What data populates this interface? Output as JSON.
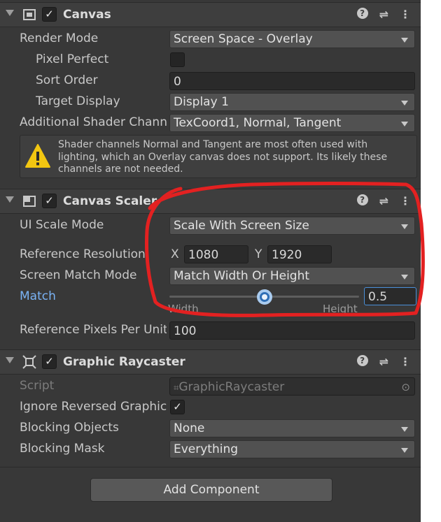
{
  "canvas": {
    "title": "Canvas",
    "enabled": true,
    "render_mode": {
      "label": "Render Mode",
      "value": "Screen Space - Overlay"
    },
    "pixel_perfect": {
      "label": "Pixel Perfect",
      "checked": false
    },
    "sort_order": {
      "label": "Sort Order",
      "value": "0"
    },
    "target_display": {
      "label": "Target Display",
      "value": "Display 1"
    },
    "shader_channels": {
      "label": "Additional Shader Channels",
      "value": "TexCoord1, Normal, Tangent"
    },
    "warning": {
      "line1": "Shader channels Normal and Tangent are most often used with",
      "line2": "lighting, which an Overlay canvas does not support. Its likely these",
      "line3": "channels are not needed."
    }
  },
  "canvas_scaler": {
    "title": "Canvas Scaler",
    "enabled": true,
    "ui_scale_mode": {
      "label": "UI Scale Mode",
      "value": "Scale With Screen Size"
    },
    "reference_resolution": {
      "label": "Reference Resolution",
      "x_label": "X",
      "x": "1080",
      "y_label": "Y",
      "y": "1920"
    },
    "screen_match_mode": {
      "label": "Screen Match Mode",
      "value": "Match Width Or Height"
    },
    "match": {
      "label": "Match",
      "value": "0.5",
      "slider_fraction": 0.5,
      "left_label": "Width",
      "right_label": "Height"
    },
    "reference_pixels_per_unit": {
      "label": "Reference Pixels Per Unit",
      "value": "100"
    }
  },
  "graphic_raycaster": {
    "title": "Graphic Raycaster",
    "enabled": true,
    "script": {
      "label": "Script",
      "value": "GraphicRaycaster"
    },
    "ignore_reversed": {
      "label": "Ignore Reversed Graphics",
      "checked": true
    },
    "blocking_objects": {
      "label": "Blocking Objects",
      "value": "None"
    },
    "blocking_mask": {
      "label": "Blocking Mask",
      "value": "Everything"
    }
  },
  "add_component_label": "Add Component",
  "colors": {
    "panel": "#383838",
    "header": "#3e3e3e",
    "accent": "#4a90d9",
    "annotation": "#e32121",
    "warning": "#f2c611"
  }
}
